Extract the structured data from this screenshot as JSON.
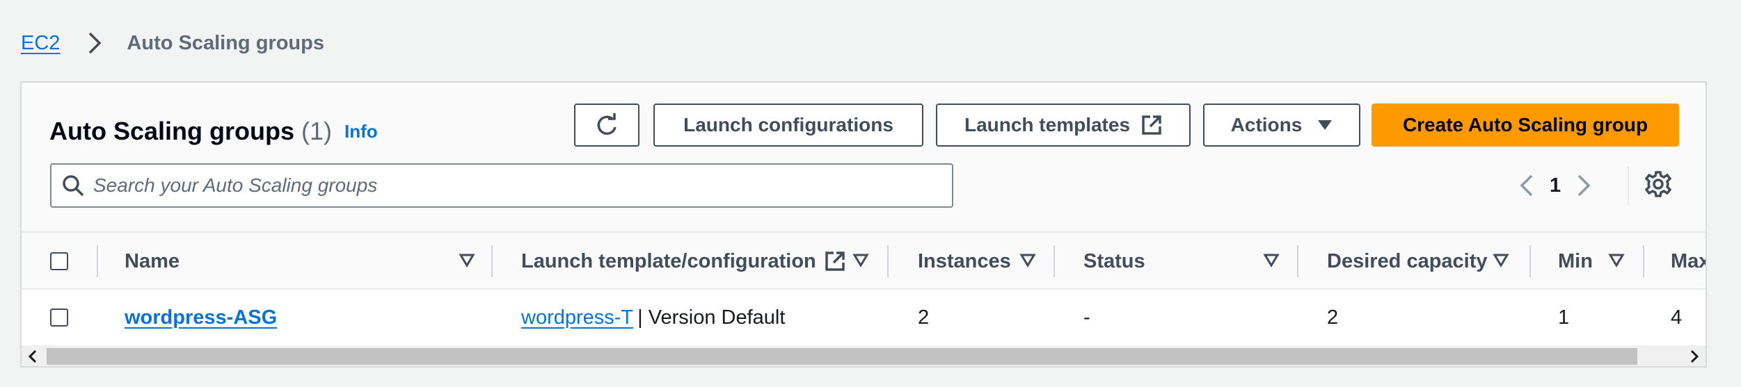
{
  "breadcrumb": {
    "parent": "EC2",
    "current": "Auto Scaling groups"
  },
  "panel": {
    "title": "Auto Scaling groups",
    "count": "(1)",
    "info": "Info"
  },
  "toolbar": {
    "refresh_icon": "refresh-icon",
    "launch_configurations": "Launch configurations",
    "launch_templates": "Launch templates",
    "launch_templates_icon": "external-link-icon",
    "actions": "Actions",
    "actions_icon": "caret-down-icon",
    "create": "Create Auto Scaling group"
  },
  "search": {
    "placeholder": "Search your Auto Scaling groups",
    "value": ""
  },
  "pagination": {
    "current_page": "1"
  },
  "table": {
    "columns": [
      "Name",
      "Launch template/configuration",
      "Instances",
      "Status",
      "Desired capacity",
      "Min",
      "Max"
    ],
    "rows": [
      {
        "name": "wordpress-ASG",
        "launch_template": "wordpress-T",
        "launch_template_version": "| Version Default",
        "instances": "2",
        "status": "-",
        "desired_capacity": "2",
        "min": "1",
        "max": "4"
      }
    ]
  },
  "colors": {
    "link": "#0972d3",
    "primary": "#ff9900",
    "text": "#16191f",
    "muted": "#5f6b7a"
  }
}
